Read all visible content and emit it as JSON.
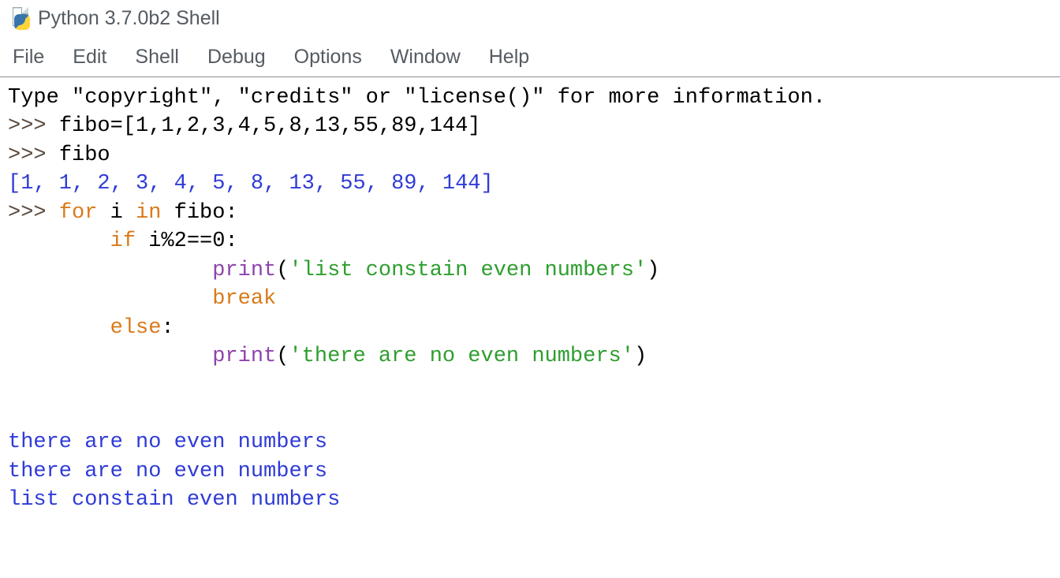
{
  "window": {
    "title": "Python 3.7.0b2 Shell"
  },
  "menu": {
    "file": "File",
    "edit": "Edit",
    "shell": "Shell",
    "debug": "Debug",
    "options": "Options",
    "window": "Window",
    "help": "Help"
  },
  "code": {
    "banner": "Type \"copyright\", \"credits\" or \"license()\" for more information.",
    "prompt": ">>> ",
    "line1_code": "fibo=[1,1,2,3,4,5,8,13,55,89,144]",
    "line2_code": "fibo",
    "line2_output": "[1, 1, 2, 3, 4, 5, 8, 13, 55, 89, 144]",
    "for_kw": "for",
    "for_rest": " i ",
    "in_kw": "in",
    "for_tail": " fibo:",
    "if_indent": "        ",
    "if_kw": "if",
    "if_rest": " i%2==0:",
    "deep_indent": "                ",
    "print_kw": "print",
    "print1_open": "(",
    "print1_str": "'list constain even numbers'",
    "print1_close": ")",
    "break_kw": "break",
    "else_kw": "else",
    "else_colon": ":",
    "print2_str": "'there are no even numbers'",
    "blank": "",
    "out1": "there are no even numbers",
    "out2": "there are no even numbers",
    "out3": "list constain even numbers"
  }
}
